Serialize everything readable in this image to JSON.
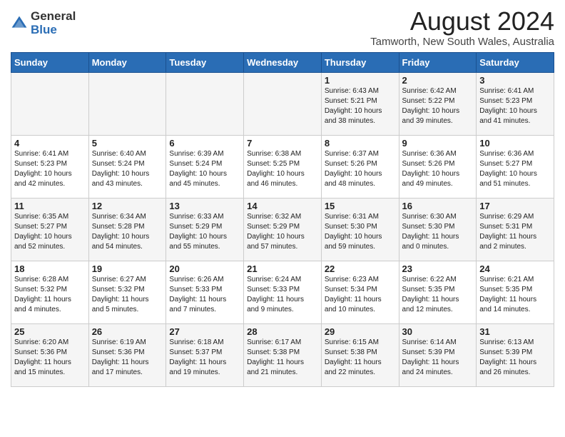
{
  "header": {
    "logo_general": "General",
    "logo_blue": "Blue",
    "month_title": "August 2024",
    "location": "Tamworth, New South Wales, Australia"
  },
  "days_of_week": [
    "Sunday",
    "Monday",
    "Tuesday",
    "Wednesday",
    "Thursday",
    "Friday",
    "Saturday"
  ],
  "weeks": [
    [
      {
        "day": "",
        "info": ""
      },
      {
        "day": "",
        "info": ""
      },
      {
        "day": "",
        "info": ""
      },
      {
        "day": "",
        "info": ""
      },
      {
        "day": "1",
        "info": "Sunrise: 6:43 AM\nSunset: 5:21 PM\nDaylight: 10 hours\nand 38 minutes."
      },
      {
        "day": "2",
        "info": "Sunrise: 6:42 AM\nSunset: 5:22 PM\nDaylight: 10 hours\nand 39 minutes."
      },
      {
        "day": "3",
        "info": "Sunrise: 6:41 AM\nSunset: 5:23 PM\nDaylight: 10 hours\nand 41 minutes."
      }
    ],
    [
      {
        "day": "4",
        "info": "Sunrise: 6:41 AM\nSunset: 5:23 PM\nDaylight: 10 hours\nand 42 minutes."
      },
      {
        "day": "5",
        "info": "Sunrise: 6:40 AM\nSunset: 5:24 PM\nDaylight: 10 hours\nand 43 minutes."
      },
      {
        "day": "6",
        "info": "Sunrise: 6:39 AM\nSunset: 5:24 PM\nDaylight: 10 hours\nand 45 minutes."
      },
      {
        "day": "7",
        "info": "Sunrise: 6:38 AM\nSunset: 5:25 PM\nDaylight: 10 hours\nand 46 minutes."
      },
      {
        "day": "8",
        "info": "Sunrise: 6:37 AM\nSunset: 5:26 PM\nDaylight: 10 hours\nand 48 minutes."
      },
      {
        "day": "9",
        "info": "Sunrise: 6:36 AM\nSunset: 5:26 PM\nDaylight: 10 hours\nand 49 minutes."
      },
      {
        "day": "10",
        "info": "Sunrise: 6:36 AM\nSunset: 5:27 PM\nDaylight: 10 hours\nand 51 minutes."
      }
    ],
    [
      {
        "day": "11",
        "info": "Sunrise: 6:35 AM\nSunset: 5:27 PM\nDaylight: 10 hours\nand 52 minutes."
      },
      {
        "day": "12",
        "info": "Sunrise: 6:34 AM\nSunset: 5:28 PM\nDaylight: 10 hours\nand 54 minutes."
      },
      {
        "day": "13",
        "info": "Sunrise: 6:33 AM\nSunset: 5:29 PM\nDaylight: 10 hours\nand 55 minutes."
      },
      {
        "day": "14",
        "info": "Sunrise: 6:32 AM\nSunset: 5:29 PM\nDaylight: 10 hours\nand 57 minutes."
      },
      {
        "day": "15",
        "info": "Sunrise: 6:31 AM\nSunset: 5:30 PM\nDaylight: 10 hours\nand 59 minutes."
      },
      {
        "day": "16",
        "info": "Sunrise: 6:30 AM\nSunset: 5:30 PM\nDaylight: 11 hours\nand 0 minutes."
      },
      {
        "day": "17",
        "info": "Sunrise: 6:29 AM\nSunset: 5:31 PM\nDaylight: 11 hours\nand 2 minutes."
      }
    ],
    [
      {
        "day": "18",
        "info": "Sunrise: 6:28 AM\nSunset: 5:32 PM\nDaylight: 11 hours\nand 4 minutes."
      },
      {
        "day": "19",
        "info": "Sunrise: 6:27 AM\nSunset: 5:32 PM\nDaylight: 11 hours\nand 5 minutes."
      },
      {
        "day": "20",
        "info": "Sunrise: 6:26 AM\nSunset: 5:33 PM\nDaylight: 11 hours\nand 7 minutes."
      },
      {
        "day": "21",
        "info": "Sunrise: 6:24 AM\nSunset: 5:33 PM\nDaylight: 11 hours\nand 9 minutes."
      },
      {
        "day": "22",
        "info": "Sunrise: 6:23 AM\nSunset: 5:34 PM\nDaylight: 11 hours\nand 10 minutes."
      },
      {
        "day": "23",
        "info": "Sunrise: 6:22 AM\nSunset: 5:35 PM\nDaylight: 11 hours\nand 12 minutes."
      },
      {
        "day": "24",
        "info": "Sunrise: 6:21 AM\nSunset: 5:35 PM\nDaylight: 11 hours\nand 14 minutes."
      }
    ],
    [
      {
        "day": "25",
        "info": "Sunrise: 6:20 AM\nSunset: 5:36 PM\nDaylight: 11 hours\nand 15 minutes."
      },
      {
        "day": "26",
        "info": "Sunrise: 6:19 AM\nSunset: 5:36 PM\nDaylight: 11 hours\nand 17 minutes."
      },
      {
        "day": "27",
        "info": "Sunrise: 6:18 AM\nSunset: 5:37 PM\nDaylight: 11 hours\nand 19 minutes."
      },
      {
        "day": "28",
        "info": "Sunrise: 6:17 AM\nSunset: 5:38 PM\nDaylight: 11 hours\nand 21 minutes."
      },
      {
        "day": "29",
        "info": "Sunrise: 6:15 AM\nSunset: 5:38 PM\nDaylight: 11 hours\nand 22 minutes."
      },
      {
        "day": "30",
        "info": "Sunrise: 6:14 AM\nSunset: 5:39 PM\nDaylight: 11 hours\nand 24 minutes."
      },
      {
        "day": "31",
        "info": "Sunrise: 6:13 AM\nSunset: 5:39 PM\nDaylight: 11 hours\nand 26 minutes."
      }
    ]
  ]
}
